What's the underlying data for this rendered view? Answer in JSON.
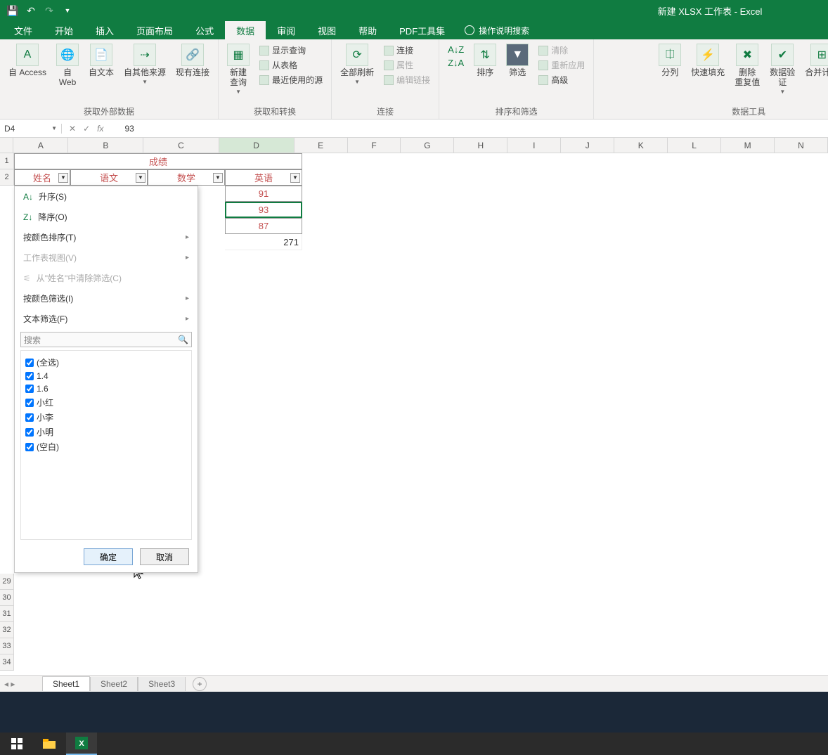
{
  "app": {
    "title": "新建 XLSX 工作表 - Excel"
  },
  "tabs": {
    "items": [
      "文件",
      "开始",
      "插入",
      "页面布局",
      "公式",
      "数据",
      "审阅",
      "视图",
      "帮助",
      "PDF工具集"
    ],
    "active_index": 5,
    "tell_me": "操作说明搜索"
  },
  "ribbon": {
    "groups": [
      {
        "label": "获取外部数据",
        "buttons": [
          {
            "label": "自 Access"
          },
          {
            "label": "自\nWeb"
          },
          {
            "label": "自文本"
          },
          {
            "label": "自其他来源"
          },
          {
            "label": "现有连接"
          }
        ]
      },
      {
        "label": "获取和转换",
        "main": {
          "label": "新建\n查询"
        },
        "items": [
          "显示查询",
          "从表格",
          "最近使用的源"
        ]
      },
      {
        "label": "连接",
        "main": {
          "label": "全部刷新"
        },
        "items": [
          "连接",
          "属性",
          "编辑链接"
        ]
      },
      {
        "label": "排序和筛选",
        "buttons": [
          {
            "label": "排序"
          },
          {
            "label": "筛选"
          }
        ],
        "items": [
          "清除",
          "重新应用",
          "高级"
        ]
      },
      {
        "label": "数据工具",
        "buttons": [
          {
            "label": "分列"
          },
          {
            "label": "快速填充"
          },
          {
            "label": "删除\n重复值"
          },
          {
            "label": "数据验\n证"
          },
          {
            "label": "合并计算"
          }
        ]
      }
    ]
  },
  "formula_bar": {
    "cell_ref": "D4",
    "fx": "fx",
    "value": "93"
  },
  "grid": {
    "col_letters": [
      "A",
      "B",
      "C",
      "D",
      "E",
      "F",
      "G",
      "H",
      "I",
      "J",
      "K",
      "L",
      "M",
      "N"
    ],
    "row1_title": "成绩",
    "headers": [
      "姓名",
      "语文",
      "数学",
      "英语"
    ],
    "colD_values": [
      "91",
      "93",
      "87"
    ],
    "colD_total": "271",
    "row_numbers_tail": [
      "29",
      "30",
      "31",
      "32",
      "33",
      "34"
    ]
  },
  "filter_menu": {
    "sort_asc": "升序(S)",
    "sort_desc": "降序(O)",
    "sort_color": "按颜色排序(T)",
    "sheet_view": "工作表视图(V)",
    "clear_filter": "从\"姓名\"中清除筛选(C)",
    "filter_color": "按颜色筛选(I)",
    "text_filter": "文本筛选(F)",
    "search_placeholder": "搜索",
    "items": [
      "(全选)",
      "1.4",
      "1.6",
      "小红",
      "小李",
      "小明",
      "(空白)"
    ],
    "ok": "确定",
    "cancel": "取消"
  },
  "sheets": {
    "tabs": [
      "Sheet1",
      "Sheet2",
      "Sheet3"
    ],
    "active": 0
  },
  "chart_data": {
    "type": "table",
    "title": "成绩",
    "columns": [
      "姓名",
      "语文",
      "数学",
      "英语"
    ],
    "visible_cells": {
      "D3": 91,
      "D4": 93,
      "D5": 87,
      "D6_total": 271
    },
    "active_cell": "D4"
  }
}
